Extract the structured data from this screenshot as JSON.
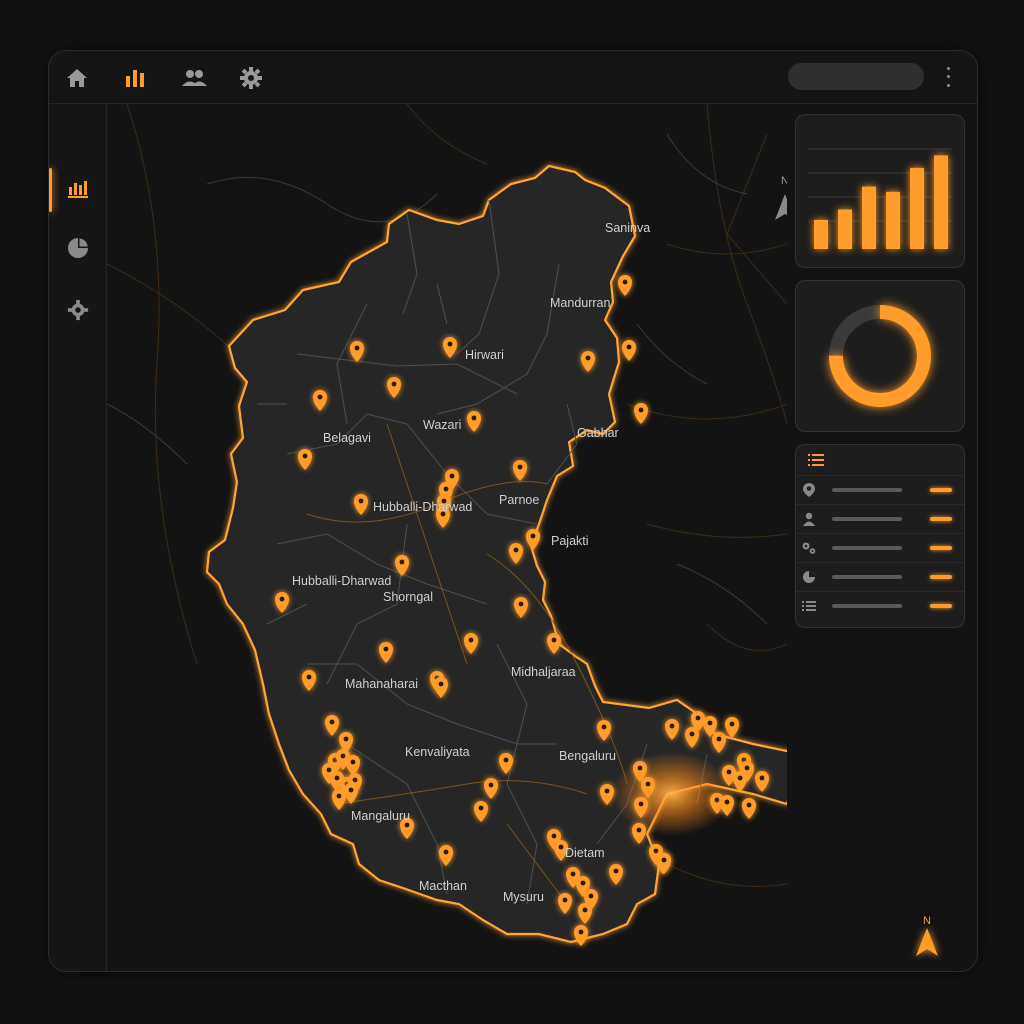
{
  "topbar": {
    "icons": [
      "home-icon",
      "bar-chart-icon",
      "users-icon",
      "gear-icon"
    ],
    "active": "bar-chart-icon"
  },
  "sidebar": {
    "icons": [
      "analytics-icon",
      "pie-chart-icon",
      "gear-icon"
    ],
    "active": "analytics-icon"
  },
  "map": {
    "north_label": "N",
    "north_label_bottom": "N",
    "cities": [
      {
        "name": "Saninva"
      },
      {
        "name": "Mandurran"
      },
      {
        "name": "Hirwari"
      },
      {
        "name": "Belagavi"
      },
      {
        "name": "Wazari"
      },
      {
        "name": "Gabhar"
      },
      {
        "name": "Parnoe"
      },
      {
        "name": "Hubballi-Dharwad"
      },
      {
        "name": "Pajakti"
      },
      {
        "name": "Hubballi-Dharwad"
      },
      {
        "name": "Shorngal"
      },
      {
        "name": "Mahanaharai"
      },
      {
        "name": "Midhaljaraa"
      },
      {
        "name": "Kenvaliyata"
      },
      {
        "name": "Bengaluru"
      },
      {
        "name": "Mangaluru"
      },
      {
        "name": "Dietam"
      },
      {
        "name": "Macthan"
      },
      {
        "name": "Mysuru"
      }
    ],
    "scale_fill_fraction": 0.75
  },
  "bar_widget": {
    "values": [
      28,
      38,
      60,
      55,
      78,
      90
    ],
    "ymax": 100
  },
  "donut_widget": {
    "fraction": 0.75
  },
  "legend_widget": {
    "header_icon": "list-icon",
    "rows": [
      {
        "icon": "pin-icon"
      },
      {
        "icon": "user-icon"
      },
      {
        "icon": "gears-icon"
      },
      {
        "icon": "pie-chart-icon"
      },
      {
        "icon": "list-icon"
      }
    ]
  },
  "colors": {
    "accent": "#ff9c2a",
    "background": "#141414",
    "panel": "#1d1d1d",
    "region": "#2a2a2a"
  }
}
